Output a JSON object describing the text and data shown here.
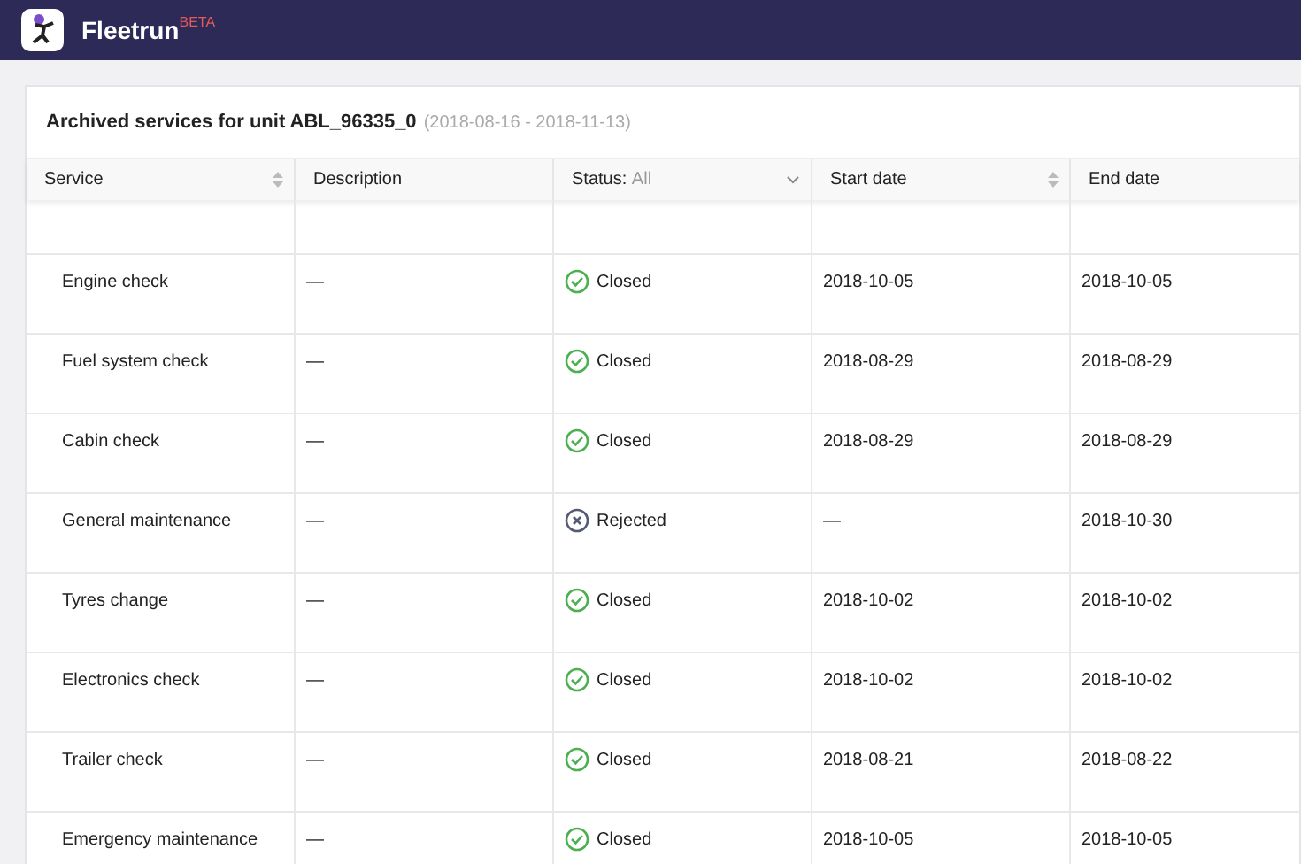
{
  "app": {
    "name": "Fleetrun",
    "badge": "BETA"
  },
  "card": {
    "title": "Archived services for unit ABL_96335_0",
    "range": "(2018-08-16 - 2018-11-13)"
  },
  "table": {
    "columns": [
      {
        "label": "Service",
        "kind": "sort"
      },
      {
        "label": "Description",
        "kind": "plain"
      },
      {
        "label": "Status:",
        "value": "All",
        "kind": "filter"
      },
      {
        "label": "Start date",
        "kind": "sort"
      },
      {
        "label": "End date",
        "kind": "plain"
      }
    ],
    "rows": [
      {
        "service": "Engine check",
        "description": "—",
        "status": {
          "kind": "closed",
          "label": "Closed"
        },
        "start": "2018-10-05",
        "end": "2018-10-05"
      },
      {
        "service": "Fuel system check",
        "description": "—",
        "status": {
          "kind": "closed",
          "label": "Closed"
        },
        "start": "2018-08-29",
        "end": "2018-08-29"
      },
      {
        "service": "Cabin check",
        "description": "—",
        "status": {
          "kind": "closed",
          "label": "Closed"
        },
        "start": "2018-08-29",
        "end": "2018-08-29"
      },
      {
        "service": "General maintenance",
        "description": "—",
        "status": {
          "kind": "rejected",
          "label": "Rejected"
        },
        "start": "—",
        "end": "2018-10-30"
      },
      {
        "service": "Tyres change",
        "description": "—",
        "status": {
          "kind": "closed",
          "label": "Closed"
        },
        "start": "2018-10-02",
        "end": "2018-10-02"
      },
      {
        "service": "Electronics check",
        "description": "—",
        "status": {
          "kind": "closed",
          "label": "Closed"
        },
        "start": "2018-10-02",
        "end": "2018-10-02"
      },
      {
        "service": "Trailer check",
        "description": "—",
        "status": {
          "kind": "closed",
          "label": "Closed"
        },
        "start": "2018-08-21",
        "end": "2018-08-22"
      },
      {
        "service": "Emergency maintenance",
        "description": "—",
        "status": {
          "kind": "closed",
          "label": "Closed"
        },
        "start": "2018-10-05",
        "end": "2018-10-05"
      }
    ]
  }
}
